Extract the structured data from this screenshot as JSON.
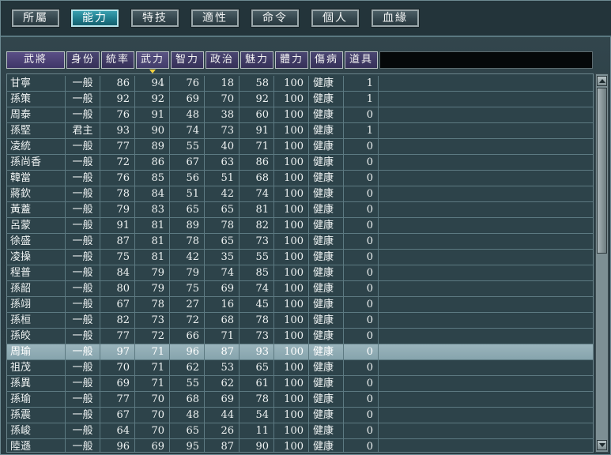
{
  "tabs": [
    {
      "label": "所屬",
      "active": false
    },
    {
      "label": "能力",
      "active": true
    },
    {
      "label": "特技",
      "active": false
    },
    {
      "label": "適性",
      "active": false
    },
    {
      "label": "命令",
      "active": false
    },
    {
      "label": "個人",
      "active": false
    },
    {
      "label": "血緣",
      "active": false
    }
  ],
  "columns": [
    "武將",
    "身份",
    "統率",
    "武力",
    "智力",
    "政治",
    "魅力",
    "體力",
    "傷病",
    "道具"
  ],
  "sorted_column": "武力",
  "rows": [
    [
      "甘寧",
      "一般",
      "86",
      "94",
      "76",
      "18",
      "58",
      "100",
      "健康",
      "1"
    ],
    [
      "孫策",
      "一般",
      "92",
      "92",
      "69",
      "70",
      "92",
      "100",
      "健康",
      "1"
    ],
    [
      "周泰",
      "一般",
      "76",
      "91",
      "48",
      "38",
      "60",
      "100",
      "健康",
      "0"
    ],
    [
      "孫堅",
      "君主",
      "93",
      "90",
      "74",
      "73",
      "91",
      "100",
      "健康",
      "1"
    ],
    [
      "凌統",
      "一般",
      "77",
      "89",
      "55",
      "40",
      "71",
      "100",
      "健康",
      "0"
    ],
    [
      "孫尚香",
      "一般",
      "72",
      "86",
      "67",
      "63",
      "86",
      "100",
      "健康",
      "0"
    ],
    [
      "韓當",
      "一般",
      "76",
      "85",
      "56",
      "51",
      "68",
      "100",
      "健康",
      "0"
    ],
    [
      "蔣欽",
      "一般",
      "78",
      "84",
      "51",
      "42",
      "74",
      "100",
      "健康",
      "0"
    ],
    [
      "黃蓋",
      "一般",
      "79",
      "83",
      "65",
      "65",
      "81",
      "100",
      "健康",
      "0"
    ],
    [
      "呂蒙",
      "一般",
      "91",
      "81",
      "89",
      "78",
      "82",
      "100",
      "健康",
      "0"
    ],
    [
      "徐盛",
      "一般",
      "87",
      "81",
      "78",
      "65",
      "73",
      "100",
      "健康",
      "0"
    ],
    [
      "凌操",
      "一般",
      "75",
      "81",
      "42",
      "35",
      "55",
      "100",
      "健康",
      "0"
    ],
    [
      "程普",
      "一般",
      "84",
      "79",
      "79",
      "74",
      "85",
      "100",
      "健康",
      "0"
    ],
    [
      "孫韶",
      "一般",
      "80",
      "79",
      "75",
      "69",
      "74",
      "100",
      "健康",
      "0"
    ],
    [
      "孫翊",
      "一般",
      "67",
      "78",
      "27",
      "16",
      "45",
      "100",
      "健康",
      "0"
    ],
    [
      "孫桓",
      "一般",
      "82",
      "73",
      "72",
      "68",
      "78",
      "100",
      "健康",
      "0"
    ],
    [
      "孫皎",
      "一般",
      "77",
      "72",
      "66",
      "71",
      "73",
      "100",
      "健康",
      "0"
    ],
    [
      "周瑜",
      "一般",
      "97",
      "71",
      "96",
      "87",
      "93",
      "100",
      "健康",
      "0"
    ],
    [
      "祖茂",
      "一般",
      "70",
      "71",
      "62",
      "53",
      "65",
      "100",
      "健康",
      "0"
    ],
    [
      "孫異",
      "一般",
      "69",
      "71",
      "55",
      "62",
      "61",
      "100",
      "健康",
      "0"
    ],
    [
      "孫瑜",
      "一般",
      "77",
      "70",
      "68",
      "69",
      "78",
      "100",
      "健康",
      "0"
    ],
    [
      "孫震",
      "一般",
      "67",
      "70",
      "48",
      "44",
      "54",
      "100",
      "健康",
      "0"
    ],
    [
      "孫峻",
      "一般",
      "64",
      "70",
      "65",
      "26",
      "11",
      "100",
      "健康",
      "0"
    ],
    [
      "陸遜",
      "一般",
      "96",
      "69",
      "95",
      "87",
      "90",
      "100",
      "健康",
      "0"
    ]
  ],
  "selected_row": 17,
  "colors": {
    "active_tab": "#1f7c8c",
    "header": "#363058",
    "selected_row": "#9ab4bc"
  }
}
